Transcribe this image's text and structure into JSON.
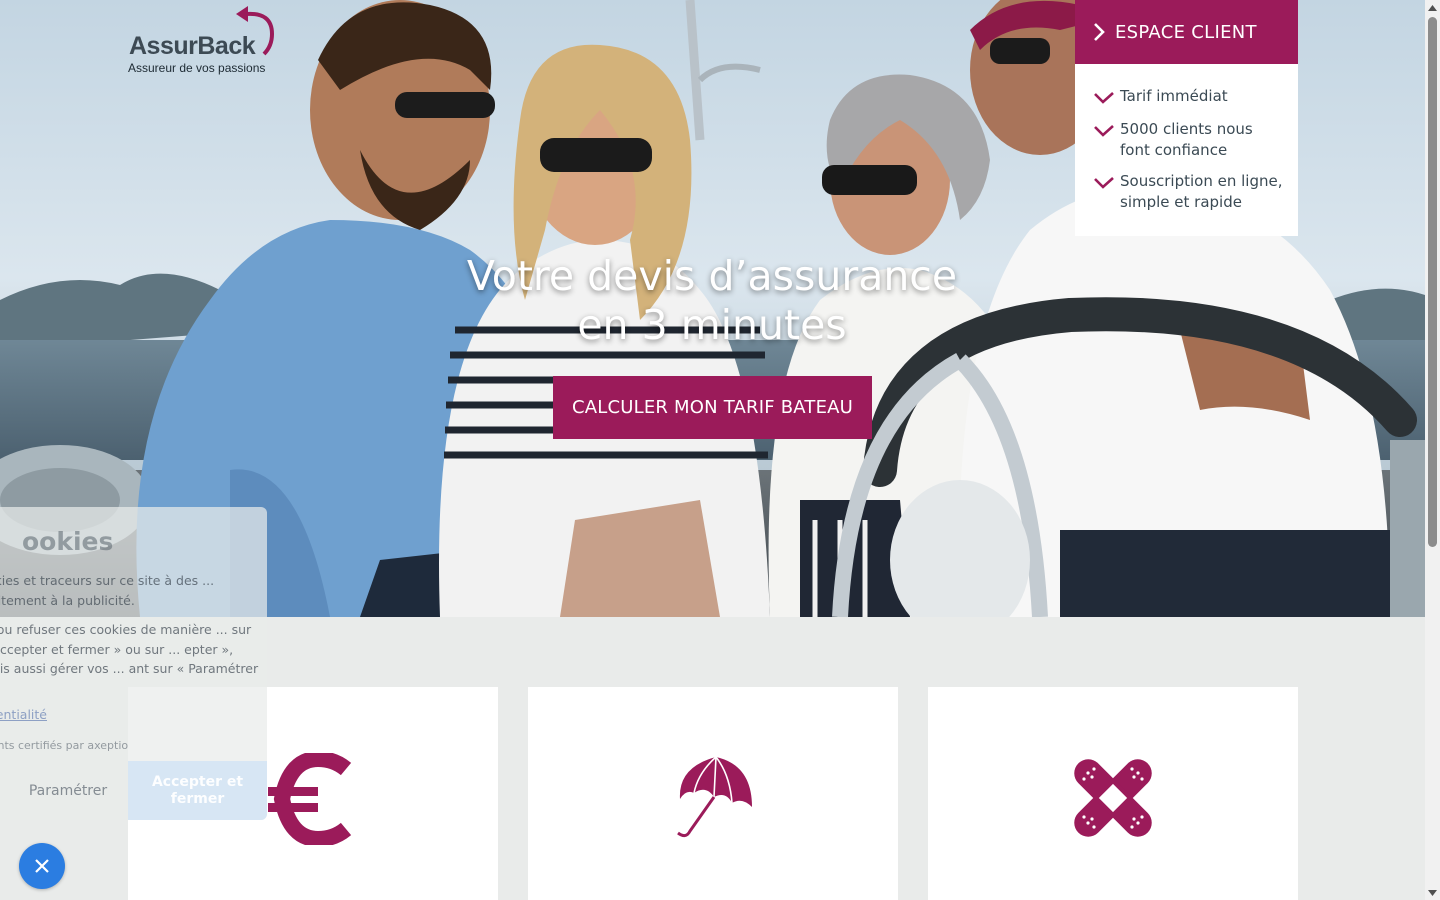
{
  "brand": {
    "name": "AssurBack",
    "tagline": "Assureur de vos passions",
    "accent_color": "#9b1b5a"
  },
  "hero": {
    "title_line1": "Votre devis d’assurance",
    "title_line2": "en 3 minutes",
    "cta_label": "CALCULER MON TARIF BATEAU"
  },
  "espace_client": {
    "label": "ESPACE CLIENT",
    "icon": "chevron-right-icon"
  },
  "benefits": [
    {
      "icon": "check-icon",
      "text": "Tarif immédiat"
    },
    {
      "icon": "check-icon",
      "text": "5000 clients nous font confiance"
    },
    {
      "icon": "check-icon",
      "text": "Souscription en ligne, simple et rapide"
    }
  ],
  "cards": [
    {
      "icon": "euro-icon"
    },
    {
      "icon": "umbrella-icon"
    },
    {
      "icon": "bandage-icon"
    }
  ],
  "cookie_banner": {
    "title": "ookies",
    "text1": "ockies et traceurs sur ce site à des ... traitement à la publicité.",
    "text2": "er ou refuser ces cookies de manière ... sur « Accepter et fermer » ou sur ... epter », mais aussi gérer vos ... ant sur « Paramétrer ».",
    "privacy_link": "fidentialité",
    "certified_text": "ments certifiés par",
    "certified_brand": "axeptio",
    "parametrer_label": "Paramétrer",
    "accepter_label": "Accepter et fermer",
    "close_icon": "close-icon",
    "button_color": "#2b7de1"
  }
}
